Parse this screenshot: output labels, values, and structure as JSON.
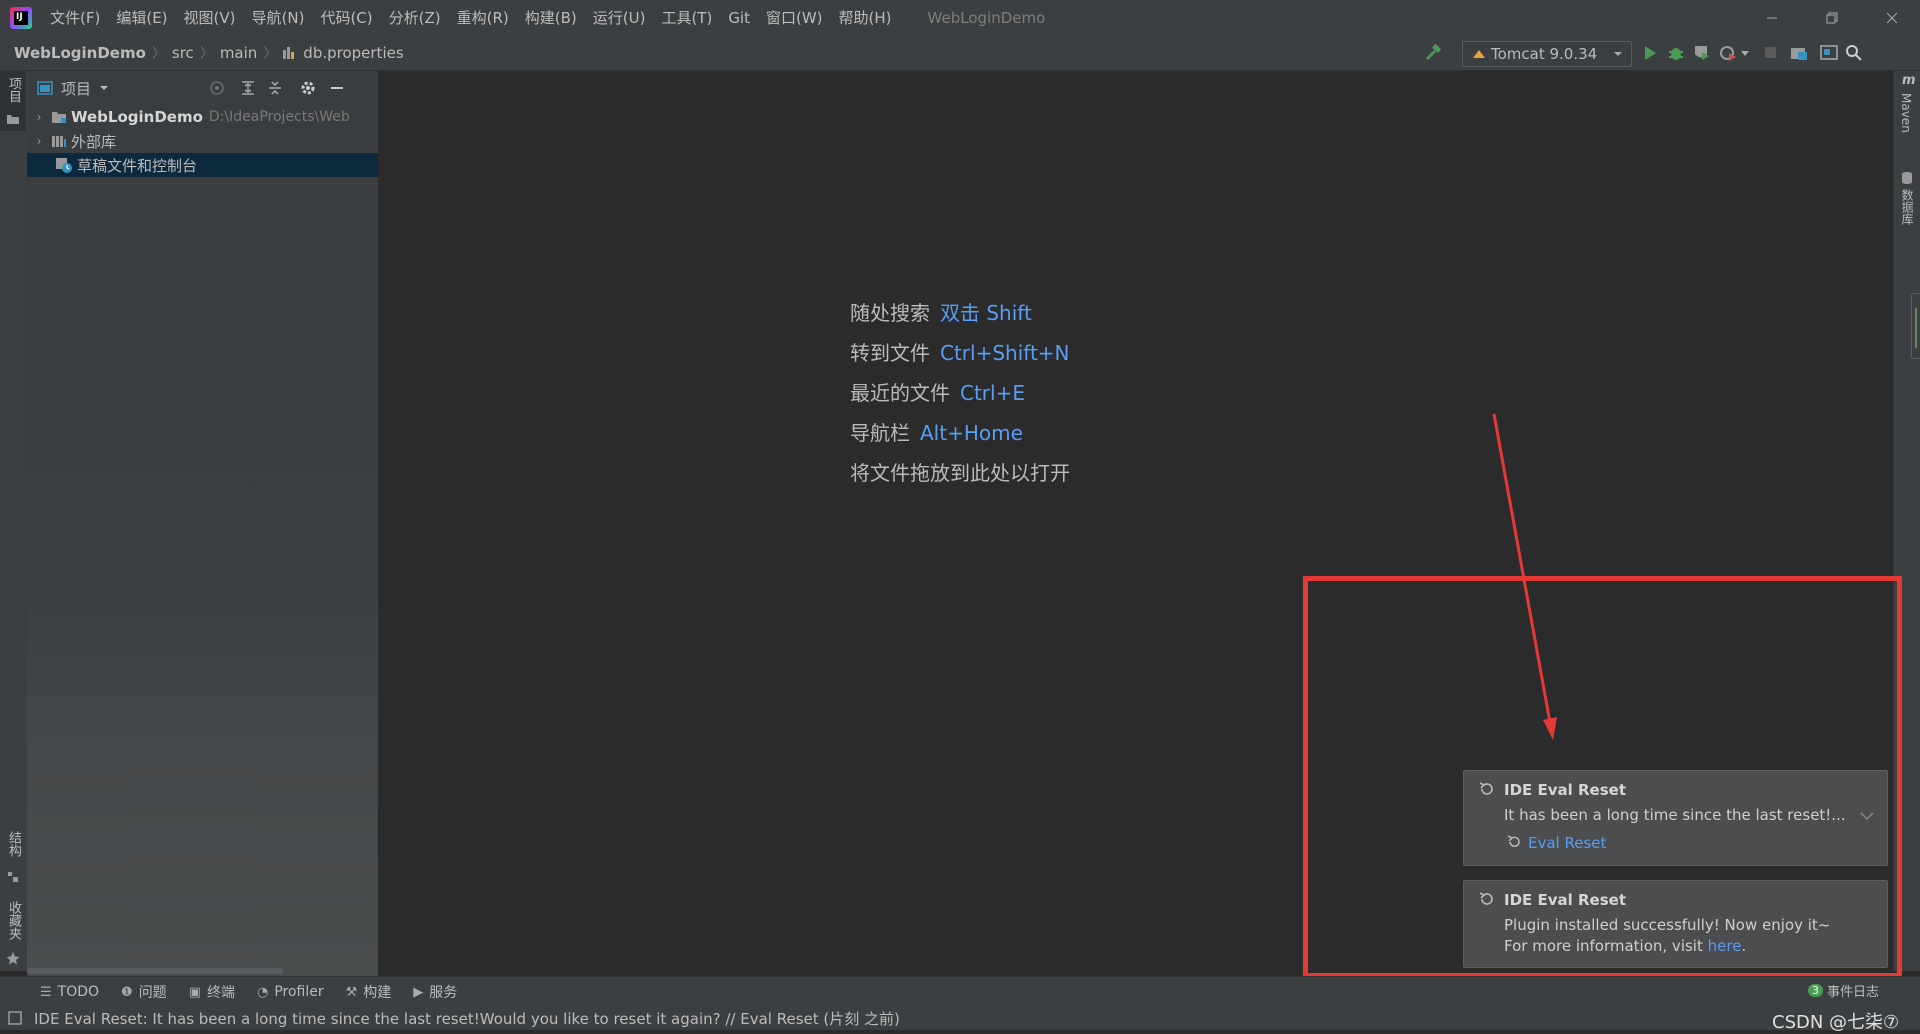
{
  "titlebar": {
    "app_icon_text": "IJ",
    "menus": [
      "文件(F)",
      "编辑(E)",
      "视图(V)",
      "导航(N)",
      "代码(C)",
      "分析(Z)",
      "重构(R)",
      "构建(B)",
      "运行(U)",
      "工具(T)",
      "Git",
      "窗口(W)",
      "帮助(H)"
    ],
    "window_title": "WebLoginDemo"
  },
  "breadcrumb": {
    "project": "WebLoginDemo",
    "folder1": "src",
    "folder2": "main",
    "file": "db.properties"
  },
  "toolbar": {
    "run_config": "Tomcat 9.0.34"
  },
  "left_strip": {
    "project_tab": "项目",
    "structure_tab": "结构",
    "favorites_tab": "收藏夹"
  },
  "right_strip": {
    "maven_tab": "Maven",
    "database_tab": "数据库"
  },
  "project_panel": {
    "title": "项目",
    "tree": [
      {
        "label": "WebLoginDemo",
        "path": "D:\\IdeaProjects\\WebLc"
      },
      {
        "label": "外部库"
      },
      {
        "label": "草稿文件和控制台"
      }
    ]
  },
  "editor_hints": [
    {
      "label": "随处搜索",
      "key": "双击 Shift"
    },
    {
      "label": "转到文件",
      "key": "Ctrl+Shift+N"
    },
    {
      "label": "最近的文件",
      "key": "Ctrl+E"
    },
    {
      "label": "导航栏",
      "key": "Alt+Home"
    },
    {
      "label": "将文件拖放到此处以打开",
      "key": ""
    }
  ],
  "notifications": [
    {
      "title": "IDE Eval Reset",
      "body": "It has been a long time since the last reset!...",
      "action": "Eval Reset"
    },
    {
      "title": "IDE Eval Reset",
      "body1": "Plugin installed successfully! Now enjoy it~",
      "body2_prefix": "For more information, visit ",
      "link": "here",
      "body2_suffix": "."
    }
  ],
  "bottom_tools": [
    "TODO",
    "问题",
    "终端",
    "Profiler",
    "构建",
    "服务"
  ],
  "event_log": {
    "count": "3",
    "label": "事件日志"
  },
  "status_bar": {
    "message": "IDE Eval Reset: It has been a long time since the last reset!Would you like to reset it again? // Eval Reset (片刻 之前)",
    "watermark": "CSDN @七柒⑦"
  },
  "colors": {
    "accent": "#589df6",
    "annotation": "#e53935",
    "selection": "#0d293e"
  }
}
